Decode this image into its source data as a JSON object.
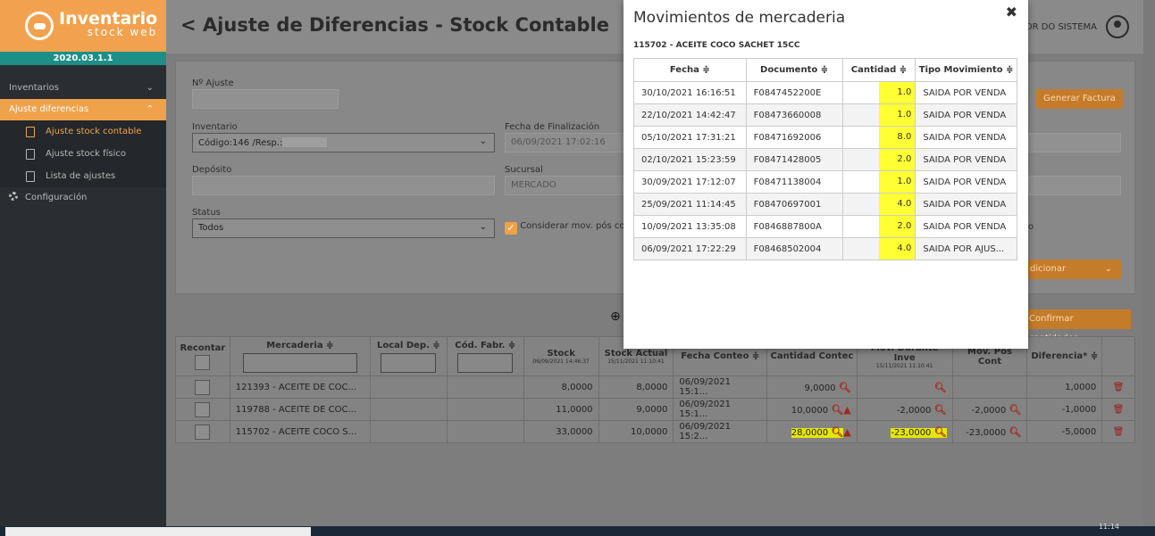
{
  "app": {
    "brand": "Inventario",
    "brand_sub": "stock web",
    "version": "2020.03.1.1"
  },
  "sidebar": {
    "items": [
      {
        "label": "Inventarios"
      },
      {
        "label": "Ajuste diferencias"
      }
    ],
    "sub": [
      {
        "label": "Ajuste stock contable"
      },
      {
        "label": "Ajuste stock físico"
      },
      {
        "label": "Lista de ajustes"
      }
    ],
    "config": "Configuración"
  },
  "header": {
    "back": "<",
    "title": "Ajuste de Diferencias - Stock Contable",
    "user": "OR DO SISTEMA"
  },
  "form": {
    "ajuste_label": "Nº Ajuste",
    "ajuste_value": "",
    "inventario_label": "Inventario",
    "inventario_value": "Código:146 /Resp.:",
    "fecha_label": "Fecha de Finalización",
    "fecha_value": "06/09/2021 17:02:16",
    "deposito_label": "Depósito",
    "deposito_value": "",
    "sucursal_label": "Sucursal",
    "sucursal_value": "MERCADO",
    "status_label": "Status",
    "status_value": "Todos",
    "considerar": "Considerar mov. pós co",
    "trailing_letter": "o",
    "generar": "Generar Factura",
    "adicionar": "dicionar",
    "confirmar": "Confirmar cantidades"
  },
  "grid": {
    "headers": {
      "recontar": "Recontar",
      "mercaderia": "Mercaderia ≑",
      "local": "Local Dep. ≑",
      "cod": "Cód. Fabr. ≑",
      "stock": "Stock",
      "stock_date": "06/09/2021 14:46:37",
      "stock_actual": "Stock Actual",
      "stock_actual_date": "15/11/2021 11:10:41",
      "fecha": "Fecha Conteo ≑",
      "cantidad": "Cantidad Contec",
      "mov_durante": "Mov. Durante Inve",
      "mov_durante_date": "15/11/2021 11:10:41",
      "mov_pos": "Mov. Pós Cont",
      "diferencia": "Diferencia* ≑"
    },
    "rows": [
      {
        "mercaderia": "121393 - ACEITE DE COC...",
        "stock": "8,0000",
        "stock_actual": "8,0000",
        "fecha": "06/09/2021 15:1...",
        "cantidad": "9,0000",
        "mov_durante": "",
        "mov_pos": "",
        "diferencia": "1,0000"
      },
      {
        "mercaderia": "119788 - ACEITE DE COC...",
        "stock": "11,0000",
        "stock_actual": "9,0000",
        "fecha": "06/09/2021 15:1...",
        "cantidad": "10,0000",
        "mov_durante": "-2,0000",
        "mov_pos": "-2,0000",
        "diferencia": "-1,0000"
      },
      {
        "mercaderia": "115702 - ACEITE COCO S...",
        "stock": "33,0000",
        "stock_actual": "10,0000",
        "fecha": "06/09/2021 15:2...",
        "cantidad": "28,0000",
        "mov_durante": "-23,0000",
        "mov_pos": "-23,0000",
        "diferencia": "-5,0000"
      }
    ]
  },
  "modal": {
    "title": "Movimientos de mercaderia",
    "close": "✖",
    "product": "115702 - ACEITE COCO SACHET 15CC",
    "headers": {
      "fecha": "Fecha ≑",
      "documento": "Documento ≑",
      "cantidad": "Cantidad ≑",
      "tipo": "Tipo Movimiento ≑"
    },
    "rows": [
      {
        "fecha": "30/10/2021 16:16:51",
        "documento": "F0847452200E",
        "cantidad": "1.0",
        "tipo": "SAIDA POR VENDA"
      },
      {
        "fecha": "22/10/2021 14:42:47",
        "documento": "F08473660008",
        "cantidad": "1.0",
        "tipo": "SAIDA POR VENDA"
      },
      {
        "fecha": "05/10/2021 17:31:21",
        "documento": "F08471692006",
        "cantidad": "8.0",
        "tipo": "SAIDA POR VENDA"
      },
      {
        "fecha": "02/10/2021 15:23:59",
        "documento": "F08471428005",
        "cantidad": "2.0",
        "tipo": "SAIDA POR VENDA"
      },
      {
        "fecha": "30/09/2021 17:12:07",
        "documento": "F08471138004",
        "cantidad": "1.0",
        "tipo": "SAIDA POR VENDA"
      },
      {
        "fecha": "25/09/2021 11:14:45",
        "documento": "F08470697001",
        "cantidad": "4.0",
        "tipo": "SAIDA POR VENDA"
      },
      {
        "fecha": "10/09/2021 13:35:08",
        "documento": "F0846887800A",
        "cantidad": "2.0",
        "tipo": "SAIDA POR VENDA"
      },
      {
        "fecha": "06/09/2021 17:22:29",
        "documento": "F08468502004",
        "cantidad": "4.0",
        "tipo": "SAIDA POR AJUS..."
      }
    ]
  },
  "taskbar": {
    "clock": "11:14"
  }
}
